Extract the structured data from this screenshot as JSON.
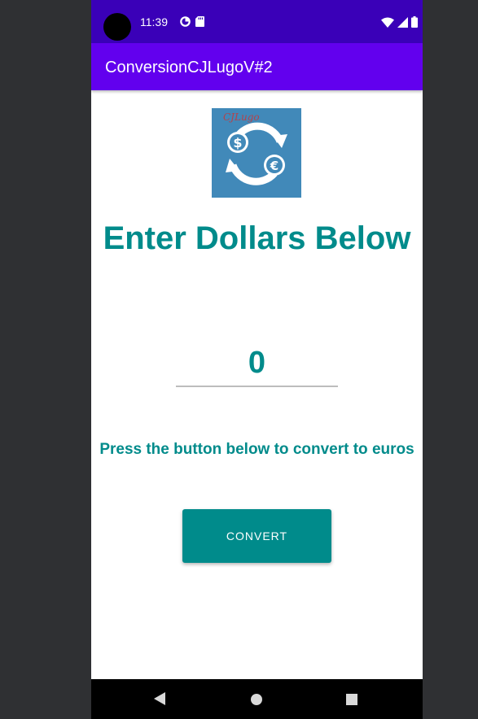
{
  "status_bar": {
    "time": "11:39",
    "left_icons": [
      "data-saver-icon",
      "sd-card-icon"
    ],
    "right_icons": [
      "wifi-icon",
      "cell-signal-icon",
      "battery-icon"
    ]
  },
  "app_bar": {
    "title": "ConversionCJLugoV#2"
  },
  "logo": {
    "signature": "CJLugo",
    "symbols": [
      "$",
      "€"
    ],
    "background": "#4189b9"
  },
  "main": {
    "heading": "Enter Dollars Below",
    "amount_value": "0",
    "instruction": "Press the button below to convert to euros",
    "convert_label": "CONVERT"
  },
  "colors": {
    "accent_teal": "#008b8b",
    "app_bar": "#6200ee",
    "status_bar": "#3a00b8"
  },
  "nav_bar": {
    "buttons": [
      "back-icon",
      "home-icon",
      "recents-icon"
    ]
  }
}
